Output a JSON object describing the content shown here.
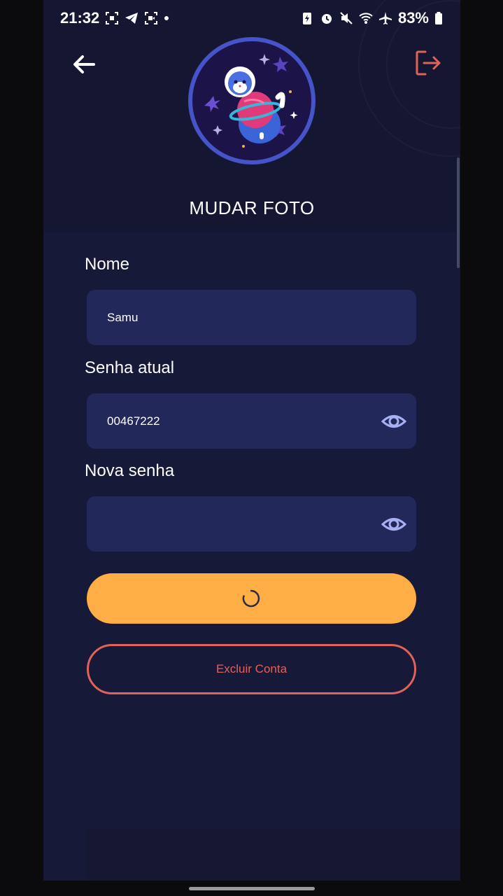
{
  "status_bar": {
    "time": "21:32",
    "battery": "83%"
  },
  "header": {
    "back_icon": "arrow-left-icon",
    "logout_icon": "logout-icon",
    "change_photo_label": "MUDAR FOTO"
  },
  "form": {
    "name_label": "Nome",
    "name_value": "Samu",
    "current_password_label": "Senha atual",
    "current_password_value": "00467222",
    "new_password_label": "Nova senha",
    "new_password_value": "",
    "eye_icon": "eye-icon"
  },
  "actions": {
    "save_state": "loading",
    "delete_account_label": "Excluir Conta"
  },
  "colors": {
    "background": "#171938",
    "input_bg": "#22285a",
    "primary_button": "#ffae45",
    "danger": "#e0625a",
    "avatar_ring": "#4653c9"
  }
}
